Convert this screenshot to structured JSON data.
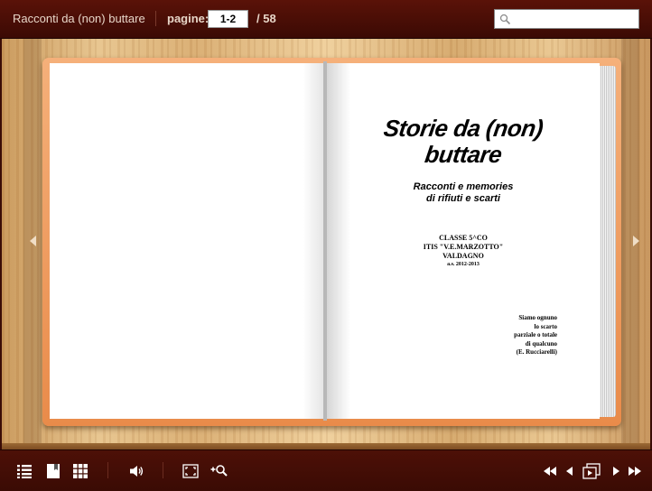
{
  "header": {
    "title": "Racconti da (non) buttare",
    "pages_label": "pagine:",
    "current_pages": "1-2",
    "total_pages": "/ 58",
    "search_placeholder": ""
  },
  "book": {
    "title_lines": [
      "Storie da (non)",
      "buttare"
    ],
    "subtitle_lines": [
      "Racconti e memories",
      "di rifiuti e scarti"
    ],
    "class_lines": [
      "CLASSE  5^CO",
      "ITIS \"V.E.MARZOTTO\"",
      "VALDAGNO"
    ],
    "school_year": "a.s. 2012-2013",
    "quote_lines": [
      "Siamo ognuno",
      "lo scarto",
      "parziale o totale",
      "di qualcuno",
      "(E. Rucciarelli)"
    ]
  },
  "colors": {
    "bar_bg": "#4a0f06",
    "bar_text": "#e8d6c8",
    "book_frame": "#ee9a5c",
    "wood": "#e0b67e"
  },
  "icons": {
    "search": "search-icon",
    "prev_page": "arrow-left-icon",
    "next_page": "arrow-right-icon",
    "toc": "list-icon",
    "bookmark": "bookmark-icon",
    "thumbnails": "grid-icon",
    "sound": "speaker-icon",
    "fullscreen": "fullscreen-icon",
    "zoom": "zoom-icon",
    "first": "first-page-icon",
    "previous": "previous-icon",
    "autoplay": "autoplay-icon",
    "next": "next-icon",
    "last": "last-page-icon"
  }
}
